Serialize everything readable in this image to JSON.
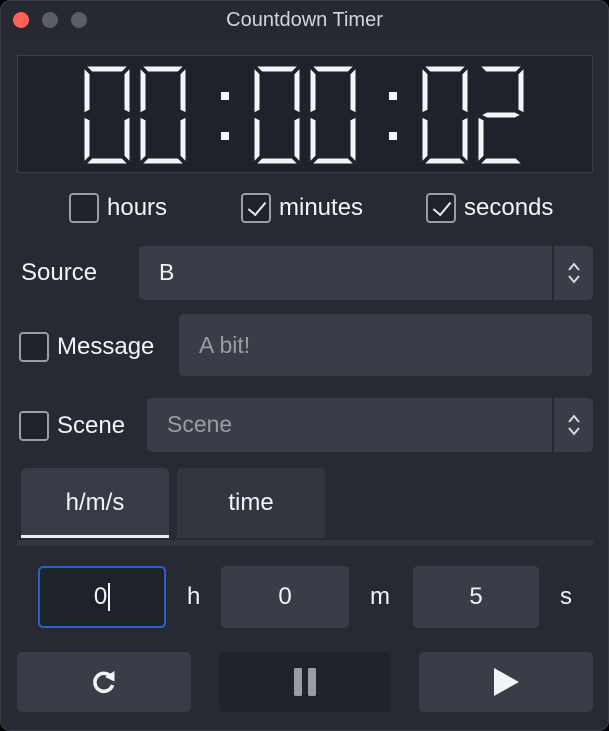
{
  "window": {
    "title": "Countdown Timer"
  },
  "display": {
    "hours": "00",
    "minutes": "00",
    "seconds": "02"
  },
  "checks": {
    "hours": {
      "label": "hours",
      "checked": false
    },
    "minutes": {
      "label": "minutes",
      "checked": true
    },
    "seconds": {
      "label": "seconds",
      "checked": true
    }
  },
  "source": {
    "label": "Source",
    "value": "B"
  },
  "message": {
    "label": "Message",
    "checked": false,
    "placeholder": "A bit!"
  },
  "scene": {
    "label": "Scene",
    "checked": false,
    "placeholder": "Scene"
  },
  "tabs": [
    {
      "label": "h/m/s",
      "active": true
    },
    {
      "label": "time",
      "active": false
    }
  ],
  "duration": {
    "hours": "0",
    "hours_unit": "h",
    "minutes": "0",
    "minutes_unit": "m",
    "seconds": "5",
    "seconds_unit": "s"
  },
  "buttons": {
    "reset": "reset-icon",
    "pause": "pause-icon",
    "play": "play-icon"
  },
  "colors": {
    "accent": "#2c5fc9",
    "close": "#fe5f57",
    "background": "#272a33"
  }
}
